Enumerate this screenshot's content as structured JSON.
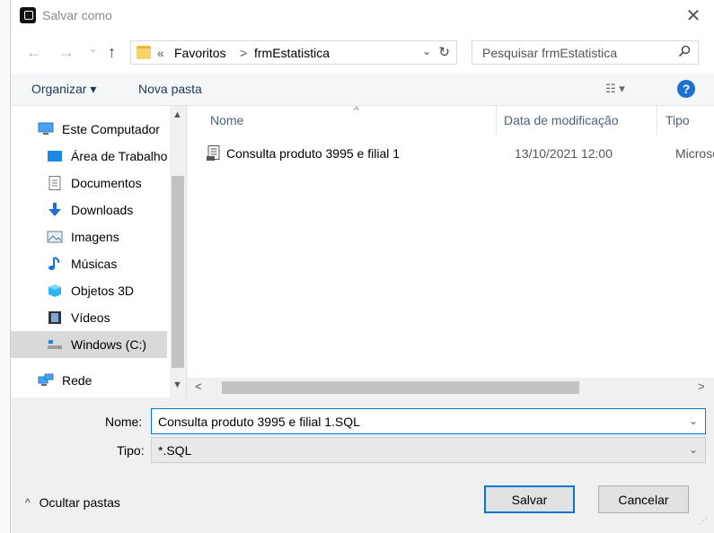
{
  "window": {
    "title": "Salvar como",
    "close_glyph": "✕"
  },
  "nav": {
    "back_glyph": "←",
    "forward_glyph": "→",
    "recent_glyph": "⌄",
    "up_glyph": "↑"
  },
  "address": {
    "chevron": "«",
    "crumbs": [
      "Favoritos",
      "frmEstatistica"
    ],
    "separator": ">",
    "dropdown_glyph": "⌄",
    "refresh_glyph": "↻"
  },
  "search": {
    "placeholder": "Pesquisar frmEstatistica",
    "icon": "search-icon"
  },
  "toolbar": {
    "organize_label": "Organizar ▾",
    "new_folder_label": "Nova pasta",
    "view_label": "☷ ▾",
    "help_label": "?"
  },
  "sidebar": {
    "items": [
      {
        "label": "Este Computador",
        "icon": "computer-icon"
      },
      {
        "label": "Área de Trabalho",
        "icon": "desktop-icon"
      },
      {
        "label": "Documentos",
        "icon": "documents-icon"
      },
      {
        "label": "Downloads",
        "icon": "downloads-icon"
      },
      {
        "label": "Imagens",
        "icon": "pictures-icon"
      },
      {
        "label": "Músicas",
        "icon": "music-icon"
      },
      {
        "label": "Objetos 3D",
        "icon": "objects3d-icon"
      },
      {
        "label": "Vídeos",
        "icon": "videos-icon"
      },
      {
        "label": "Windows (C:)",
        "icon": "drive-icon",
        "selected": true
      },
      {
        "label": "Rede",
        "icon": "network-icon"
      }
    ]
  },
  "files": {
    "columns": [
      "Nome",
      "Data de modificação",
      "Tipo"
    ],
    "rows": [
      {
        "name": "Consulta produto 3995 e filial 1",
        "modified": "13/10/2021 12:00",
        "type": "Microso"
      }
    ]
  },
  "form": {
    "name_label": "Nome:",
    "name_value": "Consulta produto 3995 e filial 1.SQL",
    "type_label": "Tipo:",
    "type_value": "*.SQL"
  },
  "footer": {
    "hide_folders_label": "Ocultar pastas",
    "save_label": "Salvar",
    "cancel_label": "Cancelar"
  },
  "colors": {
    "accent": "#0078d7",
    "help": "#1f6fd1",
    "selected_bg": "#d9d9d9",
    "folder": "#f6d36c"
  }
}
